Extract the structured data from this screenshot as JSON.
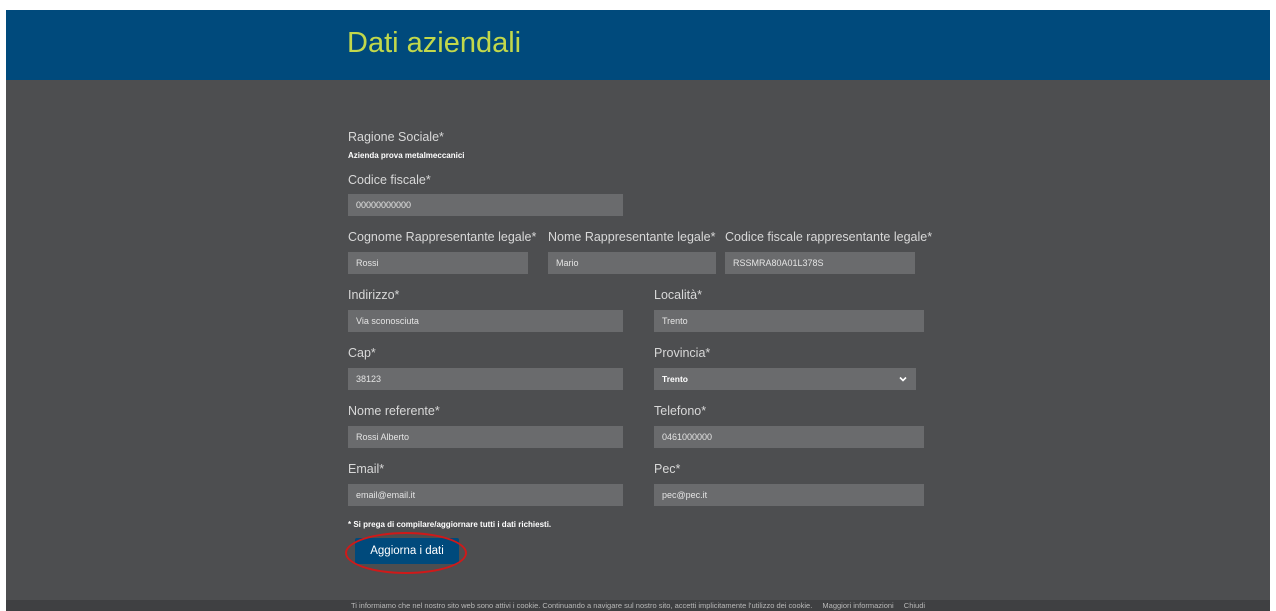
{
  "header": {
    "title": "Dati aziendali"
  },
  "form": {
    "ragione_sociale": {
      "label": "Ragione Sociale*",
      "value": "Azienda prova metalmeccanici"
    },
    "codice_fiscale": {
      "label": "Codice fiscale*",
      "value": "00000000000"
    },
    "cognome_rappresentante": {
      "label": "Cognome Rappresentante legale*",
      "value": "Rossi"
    },
    "nome_rappresentante": {
      "label": "Nome Rappresentante legale*",
      "value": "Mario"
    },
    "cf_rappresentante": {
      "label": "Codice fiscale rappresentante legale*",
      "value": "RSSMRA80A01L378S"
    },
    "indirizzo": {
      "label": "Indirizzo*",
      "value": "Via sconosciuta"
    },
    "localita": {
      "label": "Località*",
      "value": "Trento"
    },
    "cap": {
      "label": "Cap*",
      "value": "38123"
    },
    "provincia": {
      "label": "Provincia*",
      "value": "Trento"
    },
    "nome_referente": {
      "label": "Nome referente*",
      "value": "Rossi Alberto"
    },
    "telefono": {
      "label": "Telefono*",
      "value": "0461000000"
    },
    "email": {
      "label": "Email*",
      "value": "email@email.it"
    },
    "pec": {
      "label": "Pec*",
      "value": "pec@pec.it"
    },
    "note": "* Si prega di compilare/aggiornare tutti i dati richiesti.",
    "submit_label": "Aggiorna i dati"
  },
  "cookie_bar": {
    "text": "Ti informiamo che nel nostro sito web sono attivi i cookie. Continuando a navigare sul nostro sito, accetti implicitamente l'utilizzo dei cookie.",
    "more_info": "Maggiori informazioni",
    "close": "Chiudi"
  }
}
